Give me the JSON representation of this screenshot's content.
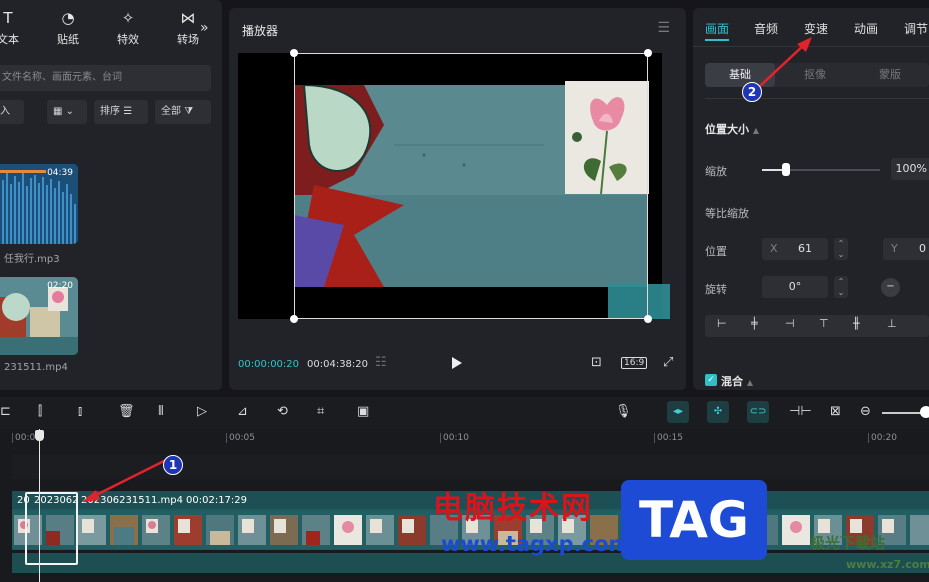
{
  "left": {
    "tabs": [
      {
        "icon": "text-icon",
        "label": "文本"
      },
      {
        "icon": "sticker-icon",
        "label": "贴纸"
      },
      {
        "icon": "effects-icon",
        "label": "特效"
      },
      {
        "icon": "transition-icon",
        "label": "转场"
      }
    ],
    "more": "»",
    "search_placeholder": "文件名称、画面元素、台词",
    "import_label": "入",
    "view_label": "▦",
    "sort_label": "排序",
    "filter_label": "全部",
    "media": [
      {
        "name": "任我行.mp3",
        "duration": "04:39"
      },
      {
        "name": "231511.mp4",
        "duration": "02:20"
      }
    ]
  },
  "player": {
    "title": "播放器",
    "current_time": "00:00:00:20",
    "total_time": "00:04:38:20",
    "ratio": "16:9"
  },
  "right": {
    "tabs": [
      "画面",
      "音频",
      "变速",
      "动画",
      "调节"
    ],
    "active_tab": "画面",
    "subtabs": [
      "基础",
      "抠像",
      "蒙版"
    ],
    "section_position": "位置大小",
    "scale_label": "缩放",
    "scale_value": "100%",
    "uniform_label": "等比缩放",
    "position_label": "位置",
    "x_key": "X",
    "x_value": "61",
    "y_key": "Y",
    "y_value": "0",
    "rotate_label": "旋转",
    "rotate_value": "0°",
    "section_blend": "混合"
  },
  "timeline": {
    "ruler": [
      "00:00",
      "00:05",
      "00:10",
      "00:15",
      "00:20"
    ],
    "clip_name": "202306231511.mp4",
    "clip_duration": "00:02:17:29",
    "clip_prefix_a": "20",
    "clip_prefix_b": "2023062"
  },
  "annotations": {
    "badge1": "1",
    "badge2": "2",
    "arrow_color": "#e3232b"
  },
  "watermark": {
    "site_cn": "电脑技术网",
    "site_url": "www.tagxp.com",
    "tag": "TAG",
    "brand": "极光下载站",
    "brand_url": "www.xz7.com"
  }
}
